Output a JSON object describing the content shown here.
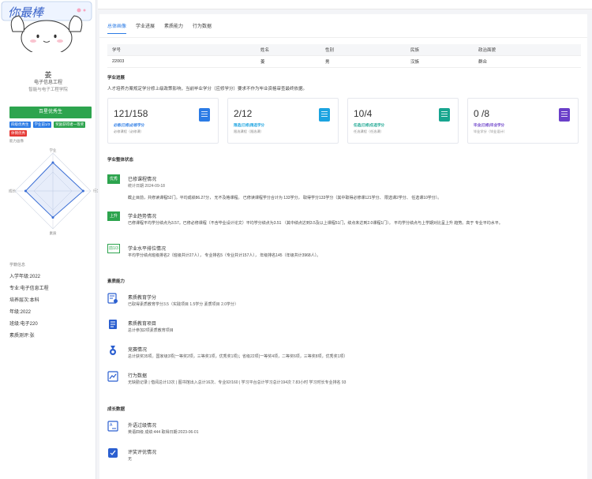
{
  "sidebar": {
    "banner_text": "你最棒",
    "name": "姜",
    "major": "电子信息工程",
    "college": "智能与电子工程学院",
    "honor_main": "百星优秀生",
    "badges": [
      {
        "label": "四级优秀生",
        "color": "#2b7be5"
      },
      {
        "label": "学业前1/3",
        "color": "#2b7be5"
      },
      {
        "label": "奖励获得者一等奖",
        "color": "#2da44e"
      },
      {
        "label": "体侧优秀",
        "color": "#e53935"
      }
    ],
    "radar_title": "能力画像",
    "radar_labels": {
      "top": "学业",
      "right": "行为",
      "bottom": "素质",
      "left": "成长"
    },
    "radar_values": [
      0.75,
      0.8,
      0.7,
      0.72
    ],
    "info_title": "学籍信息",
    "info": [
      "入学年级:2022",
      "专业:电子信息工程",
      "培养层次:本科",
      "年级:2022",
      "班级:电子220",
      "素质测评:张"
    ]
  },
  "tabs": [
    "总体画像",
    "学业进展",
    "素质能力",
    "行为数据"
  ],
  "active_tab": 0,
  "table": {
    "headers": [
      "学号",
      "姓名",
      "性别",
      "民族",
      "政治面貌"
    ],
    "row": [
      "22003",
      "姜",
      "男",
      "汉族",
      "群众"
    ]
  },
  "progress": {
    "title": "学业进展",
    "intro": "人才培养方案规定学分修上级政策影响，当前毕业学分（应修学分）要求不作为毕业资格审查最终依据。",
    "cards": [
      {
        "value": "121/158",
        "label": "必修(已修)必修学分",
        "sub": "必修课程（必修课）",
        "color": "#2b7be5"
      },
      {
        "value": "2/12",
        "label": "限选(已修)限选学分",
        "sub": "限选课程（限选课）",
        "color": "#1ba3e0"
      },
      {
        "value": "10/4",
        "label": "任选(已修)任选学分",
        "sub": "任选课程（任选课）",
        "color": "#17a58f"
      },
      {
        "value": "0 /8",
        "label": "毕业(已修)毕业学分",
        "sub": "毕业学分（毕业设计）",
        "color": "#6a3fc9"
      }
    ]
  },
  "overall": {
    "title": "学业整体状态",
    "blocks": [
      {
        "tag": "优秀",
        "head": "已修课程情况",
        "sub": "统计日期 2024-09-18",
        "desc": "截止目前，共修读课程52门。平均成绩86.27分， 无不及格课程。 已修读课程学分合计为 133学分， 取得学分133学分（其中取得必修课121学分、 限选课2学分、 任选课10学分）。"
      },
      {
        "tag": "上升",
        "head": "学业趋势情况",
        "sub": "",
        "desc": "已修课程平均学分绩点为3.57。已修必修课程（不含毕业设计论文）平均学分绩点为3.51 （其中绩点达到3.5及以上课程51门，绩点未达到2.0课程1门）。 平均学分绩点与上学期对比呈上升 趋势。高于 专业平均水平。"
      },
      {
        "tag": "前1/3",
        "head": "学业水平排位情况",
        "sub": "",
        "desc": "平均学分绩点班级排名2（班级共计27人）， 专业排名5（专业共计157人）， 年级排名145（年级共计3968人）。"
      }
    ]
  },
  "quality": {
    "title": "素质能力",
    "items": [
      {
        "icon": "certificate-icon",
        "head": "素质教育学分",
        "text": "已取得素质教育学分3.5（实践项目 1.5学分 素质项目 2.0学分）"
      },
      {
        "icon": "document-icon",
        "head": "素质教育项目",
        "text": "总计参加2项素质教育项目"
      },
      {
        "icon": "medal-icon",
        "head": "竞赛情况",
        "text": "总计获奖35项。国家级3项(一等奖2项，三等奖1项，优秀奖1项)；省级22项(一等奖4项，二等奖6项，三等奖8项，优秀奖1项）"
      },
      {
        "icon": "trend-icon",
        "head": "行为数据",
        "text": "无缺勤记录 | 借阅总计13次 | 图书馆出入总计16次、专业92/160 | 学习平台总计学习总计194次 7.83小时 学习时长专业排名 93"
      }
    ]
  },
  "growth": {
    "title": "成长数据",
    "items": [
      {
        "icon": "translate-icon",
        "head": "外语过级情况",
        "text": "英语四级 成绩:444 取得日期:2023-06-01"
      },
      {
        "icon": "evaluation-icon",
        "head": "评奖评优情况",
        "text": "无"
      }
    ]
  }
}
